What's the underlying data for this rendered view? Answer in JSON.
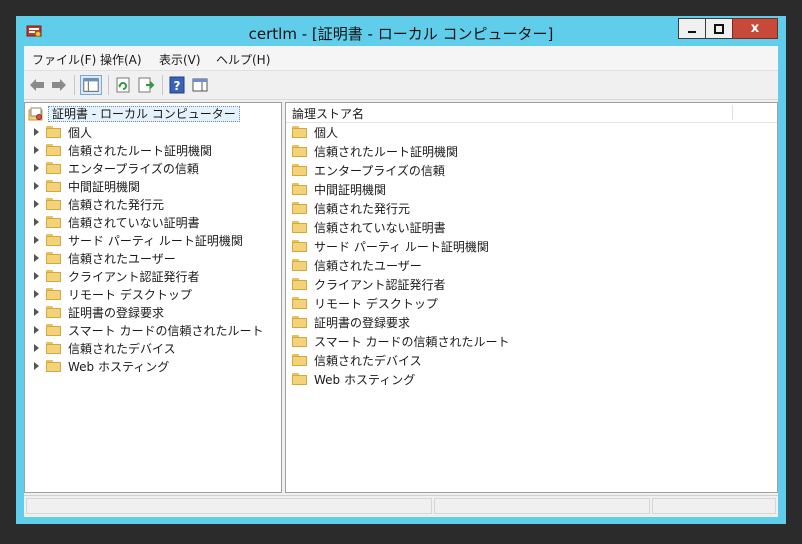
{
  "window": {
    "title": "certlm - [証明書 - ローカル コンピューター]",
    "app_icon": "certificate-console-icon"
  },
  "controls": {
    "minimize": "minimize-icon",
    "maximize": "maximize-icon",
    "close": "x"
  },
  "menu": [
    {
      "label": "ファイル(F)"
    },
    {
      "label": "操作(A)"
    },
    {
      "label": "表示(V)"
    },
    {
      "label": "ヘルプ(H)"
    }
  ],
  "toolbar": [
    "back-arrow-icon",
    "forward-arrow-icon",
    "show-hide-console-tree-icon",
    "refresh-icon",
    "export-list-icon",
    "help-icon",
    "show-hide-action-pane-icon"
  ],
  "tree": {
    "root": "証明書 - ローカル コンピューター",
    "items": [
      {
        "label": "個人"
      },
      {
        "label": "信頼されたルート証明機関"
      },
      {
        "label": "エンタープライズの信頼"
      },
      {
        "label": "中間証明機関"
      },
      {
        "label": "信頼された発行元"
      },
      {
        "label": "信頼されていない証明書"
      },
      {
        "label": "サード パーティ ルート証明機関"
      },
      {
        "label": "信頼されたユーザー"
      },
      {
        "label": "クライアント認証発行者"
      },
      {
        "label": "リモート デスクトップ"
      },
      {
        "label": "証明書の登録要求"
      },
      {
        "label": "スマート カードの信頼されたルート"
      },
      {
        "label": "信頼されたデバイス"
      },
      {
        "label": "Web ホスティング"
      }
    ]
  },
  "list": {
    "column": "論理ストア名",
    "items": [
      {
        "label": "個人"
      },
      {
        "label": "信頼されたルート証明機関"
      },
      {
        "label": "エンタープライズの信頼"
      },
      {
        "label": "中間証明機関"
      },
      {
        "label": "信頼された発行元"
      },
      {
        "label": "信頼されていない証明書"
      },
      {
        "label": "サード パーティ ルート証明機関"
      },
      {
        "label": "信頼されたユーザー"
      },
      {
        "label": "クライアント認証発行者"
      },
      {
        "label": "リモート デスクトップ"
      },
      {
        "label": "証明書の登録要求"
      },
      {
        "label": "スマート カードの信頼されたルート"
      },
      {
        "label": "信頼されたデバイス"
      },
      {
        "label": "Web ホスティング"
      }
    ]
  },
  "colors": {
    "frame": "#60cdea",
    "close_button": "#c7493a",
    "folder": "#f3d27a"
  }
}
